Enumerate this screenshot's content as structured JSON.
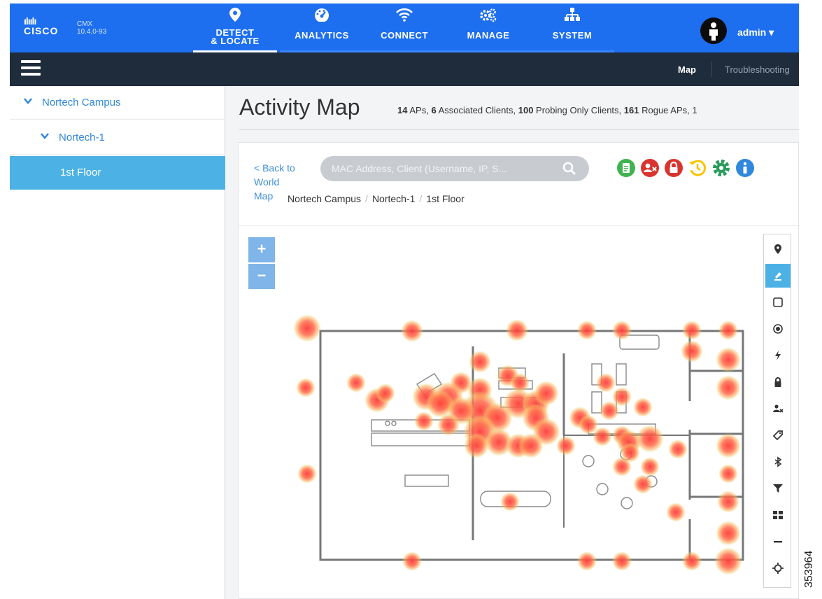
{
  "brand": {
    "logo_bars": "ılıılı",
    "logo_word": "CISCO",
    "product": "CMX",
    "version": "10.4.0-93"
  },
  "nav": {
    "tabs": [
      {
        "label_line1": "DETECT",
        "label_line2": "& LOCATE",
        "icon": "location-pin-icon",
        "active": true
      },
      {
        "label": "ANALYTICS",
        "icon": "dashboard-gauge-icon"
      },
      {
        "label": "CONNECT",
        "icon": "wifi-icon"
      },
      {
        "label": "MANAGE",
        "icon": "gears-icon"
      },
      {
        "label": "SYSTEM",
        "icon": "network-tree-icon"
      }
    ],
    "user": "admin ▾"
  },
  "subnav": {
    "map": "Map",
    "troubleshooting": "Troubleshooting"
  },
  "sidebar": {
    "items": [
      {
        "label": "Nortech Campus",
        "level": 0,
        "expanded": true
      },
      {
        "label": "Nortech-1",
        "level": 1,
        "expanded": true
      },
      {
        "label": "1st Floor",
        "level": 2,
        "selected": true
      }
    ]
  },
  "main": {
    "title": "Activity Map",
    "stats": {
      "aps_n": "14",
      "aps_t": " APs, ",
      "assoc_n": "6",
      "assoc_t": " Associated Clients, ",
      "probing_n": "100",
      "probing_t": " Probing Only Clients, ",
      "rogue_n": "161",
      "rogue_t": " Rogue APs, 1"
    },
    "back_line1": "< Back to",
    "back_line2": "World",
    "back_line3": "Map",
    "search_placeholder": "MAC Address, Client (Username, IP, S...",
    "breadcrumb": [
      "Nortech Campus",
      "Nortech-1",
      "1st Floor"
    ],
    "zoom_in": "+",
    "zoom_out": "−"
  },
  "toolbar_icons": [
    "location-pin-icon",
    "pen-icon",
    "rectangle-icon",
    "target-icon",
    "lightning-icon",
    "lock-icon",
    "user-remove-icon",
    "tag-icon",
    "bluetooth-icon",
    "filter-icon",
    "grid-icon",
    "minus-icon",
    "crosshair-icon"
  ],
  "top_tool_icons": [
    "report-icon",
    "user-remove-icon",
    "lock-icon",
    "history-icon",
    "settings-icon",
    "info-icon"
  ],
  "colors": {
    "nav_bg": "#1d6ff0",
    "subbar_bg": "#1f2c3b",
    "accent": "#4cb2e6",
    "heat": "#ff4a4a"
  },
  "doc_id": "353964"
}
